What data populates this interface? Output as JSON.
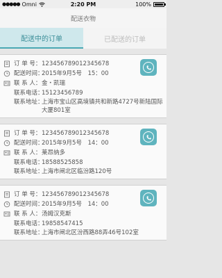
{
  "status_bar": {
    "carrier": "Omni",
    "time": "2:20 PM",
    "battery_percent_label": "100%",
    "battery_level": 1.0
  },
  "navbar": {
    "title": "配送衣物"
  },
  "tabs": [
    {
      "label": "配送中的订单",
      "active": true
    },
    {
      "label": "已配送的订单",
      "active": false
    }
  ],
  "field_labels": {
    "order_no": "订 单 号：",
    "delivery_time": "配送时间：",
    "contact": "联 系 人：",
    "phone": "联系电话：",
    "address": "联系地址："
  },
  "orders": [
    {
      "order_no": "123456789012345678",
      "delivery_time": "2015年9月5号　15：00",
      "contact": "金・凯瑞",
      "phone": "15123456789",
      "address": "上海市宝山区高境镇共和新路4727号新陆国际大厦801室"
    },
    {
      "order_no": "123456789012345678",
      "delivery_time": "2015年9月5号　14：00",
      "contact": "莱昂纳多",
      "phone": "18588525858",
      "address": "上海市闸北区临汾路120号"
    },
    {
      "order_no": "123456789012345678",
      "delivery_time": "2015年9月5号　14：00",
      "contact": "汤姆汉克斯",
      "phone": "19858547415",
      "address": "上海市闸北区汾西路88弄46号102室"
    }
  ],
  "colors": {
    "accent": "#5fb4be",
    "tab_active_bg": "#cfe8ec",
    "background": "#e6e6e6"
  }
}
